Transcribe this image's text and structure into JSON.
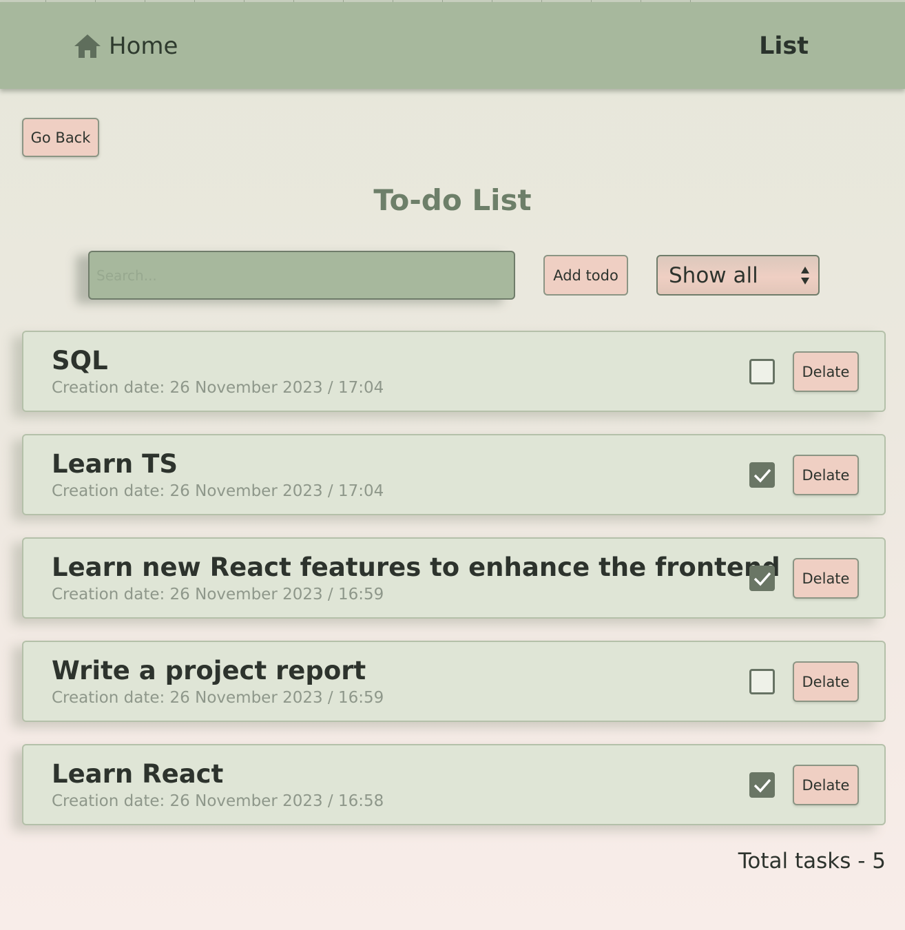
{
  "nav": {
    "home_label": "Home",
    "list_label": "List"
  },
  "go_back_label": "Go Back",
  "page_title": "To-do List",
  "search": {
    "placeholder": "Search...",
    "value": ""
  },
  "add_todo_label": "Add todo",
  "filter": {
    "selected": "Show all"
  },
  "todos": [
    {
      "title": "SQL",
      "date": "Creation date: 26 November 2023 / 17:04",
      "completed": false,
      "delete_label": "Delate"
    },
    {
      "title": "Learn TS",
      "date": "Creation date: 26 November 2023 / 17:04",
      "completed": true,
      "delete_label": "Delate"
    },
    {
      "title": "Learn new React features to enhance the frontend",
      "date": "Creation date: 26 November 2023 / 16:59",
      "completed": true,
      "delete_label": "Delate"
    },
    {
      "title": "Write a project report",
      "date": "Creation date: 26 November 2023 / 16:59",
      "completed": false,
      "delete_label": "Delate"
    },
    {
      "title": "Learn React",
      "date": "Creation date: 26 November 2023 / 16:58",
      "completed": true,
      "delete_label": "Delate"
    }
  ],
  "total_tasks": "Total tasks - 5",
  "icons": {
    "home": "home-icon",
    "select_arrows": "select-arrows-icon",
    "check": "check-icon"
  },
  "colors": {
    "navbar": "#a7b89d",
    "title": "#6d7f69",
    "button": "#efcfc3",
    "card": "#dfe5d6",
    "checkbox_checked": "#6a7665"
  }
}
